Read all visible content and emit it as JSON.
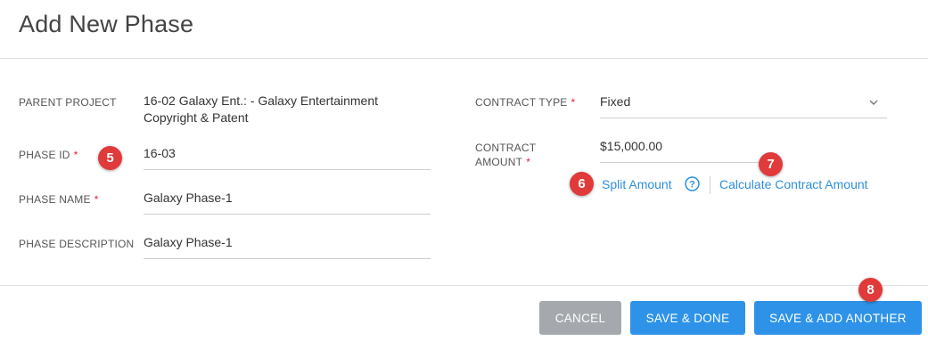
{
  "header": {
    "title": "Add New Phase"
  },
  "form": {
    "parent_project": {
      "label": "PARENT PROJECT",
      "value_line1": "16-02 Galaxy Ent.: - Galaxy Entertainment",
      "value_line2": "Copyright & Patent"
    },
    "phase_id": {
      "label": "PHASE ID",
      "required": "*",
      "value": "16-03"
    },
    "phase_name": {
      "label": "PHASE NAME",
      "required": "*",
      "value": "Galaxy Phase-1"
    },
    "phase_description": {
      "label": "PHASE DESCRIPTION",
      "value": "Galaxy Phase-1"
    },
    "contract_type": {
      "label": "CONTRACT TYPE",
      "required": "*",
      "value": "Fixed"
    },
    "contract_amount": {
      "label_line1": "CONTRACT",
      "label_line2": "AMOUNT",
      "required": "*",
      "value": "$15,000.00"
    },
    "split_amount_link": "Split Amount",
    "help_glyph": "?",
    "calculate_link": "Calculate Contract Amount"
  },
  "badges": [
    "5",
    "6",
    "7",
    "8"
  ],
  "footer": {
    "cancel": "CANCEL",
    "save_done": "SAVE & DONE",
    "save_add_another": "SAVE & ADD ANOTHER"
  },
  "colors": {
    "accent": "#2e93e8",
    "link": "#2f8fdd",
    "badge": "#e03a3a",
    "required": "#e0223a",
    "cancel": "#a5a9ad"
  },
  "icons": {
    "help": "help-circle-icon",
    "dropdown": "chevron-down-icon"
  }
}
